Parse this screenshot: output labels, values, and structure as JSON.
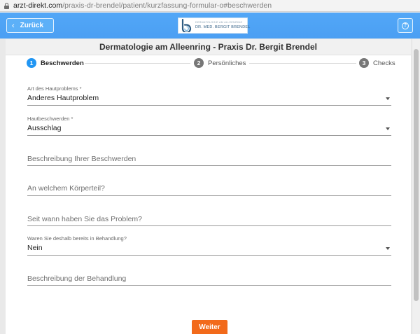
{
  "browser": {
    "url_host": "arzt-direkt.com",
    "url_path": "/praxis-dr-brendel/patient/kurzfassung-formular-o#beschwerden"
  },
  "header": {
    "back_label": "Zurück",
    "help_symbol": "?"
  },
  "logo": {
    "subtitle": "DERMATOLOGIE AM ALLEENRING",
    "name": "DR. MED. BERGIT BRENDEL",
    "accent_color": "#2e5c82"
  },
  "page": {
    "title": "Dermatologie am Alleenring - Praxis Dr. Bergit Brendel"
  },
  "stepper": {
    "steps": [
      {
        "number": "1",
        "label": "Beschwerden",
        "active": true
      },
      {
        "number": "2",
        "label": "Persönliches",
        "active": false
      },
      {
        "number": "3",
        "label": "Checks",
        "active": false
      }
    ],
    "active_color": "#2196f3"
  },
  "form": {
    "skin_problem": {
      "label": "Art des Hautproblems *",
      "value": "Anderes Hautproblem"
    },
    "skin_complaint": {
      "label": "Hautbeschwerden *",
      "value": "Ausschlag"
    },
    "description": {
      "placeholder": "Beschreibung Ihrer Beschwerden"
    },
    "body_part": {
      "placeholder": "An welchem Körperteil?"
    },
    "since_when": {
      "placeholder": "Seit wann haben Sie das Problem?"
    },
    "treated": {
      "label": "Waren Sie deshalb bereits in Behandlung?",
      "value": "Nein"
    },
    "treatment_description": {
      "placeholder": "Beschreibung der Behandlung"
    }
  },
  "footer": {
    "next_label": "Weiter",
    "next_color": "#f26a1b"
  }
}
